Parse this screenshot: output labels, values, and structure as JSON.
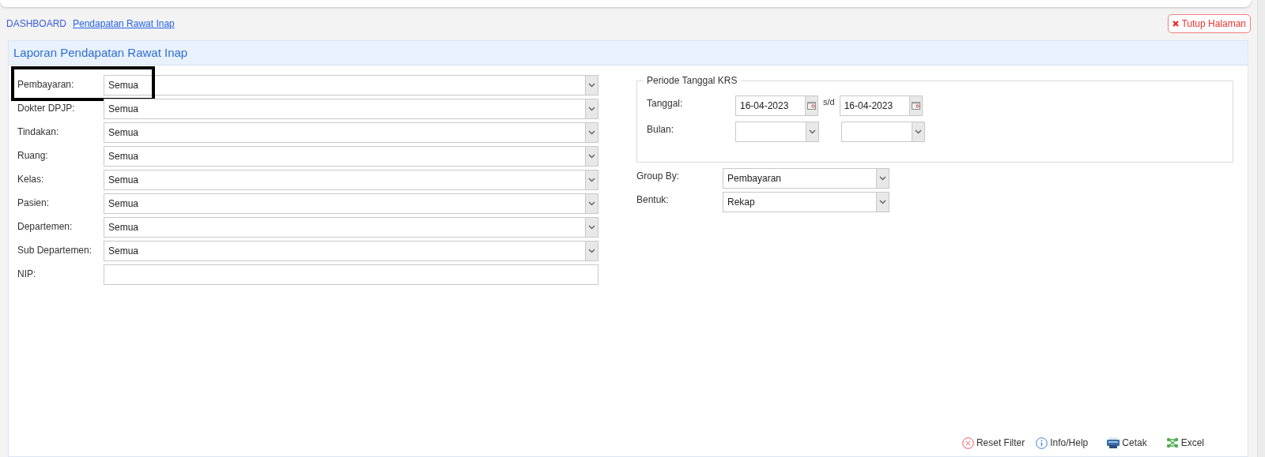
{
  "breadcrumb": [
    {
      "label": "DASHBOARD",
      "kind": "plain"
    },
    {
      "label": "Pendapatan Rawat Inap",
      "kind": "link"
    }
  ],
  "close_button": {
    "label": "Tutup Halaman"
  },
  "panel": {
    "title": "Laporan Pendapatan Rawat Inap"
  },
  "filters": [
    {
      "label": "Pembayaran:",
      "kind": "select",
      "value": "Semua",
      "highlighted": true
    },
    {
      "label": "Dokter DPJP:",
      "kind": "select",
      "value": "Semua",
      "highlighted": false
    },
    {
      "label": "Tindakan:",
      "kind": "select",
      "value": "Semua",
      "highlighted": false
    },
    {
      "label": "Ruang:",
      "kind": "select",
      "value": "Semua",
      "highlighted": false
    },
    {
      "label": "Kelas:",
      "kind": "select",
      "value": "Semua",
      "highlighted": false
    },
    {
      "label": "Pasien:",
      "kind": "select",
      "value": "Semua",
      "highlighted": false
    },
    {
      "label": "Departemen:",
      "kind": "select",
      "value": "Semua",
      "highlighted": false
    },
    {
      "label": "Sub Departemen:",
      "kind": "select",
      "value": "Semua",
      "highlighted": false
    },
    {
      "label": "NIP:",
      "kind": "text",
      "highlighted": false
    }
  ],
  "period": {
    "legend": "Periode Tanggal KRS",
    "date_label": "Tanggal:",
    "date_from": "16-04-2023",
    "separator": "s/d",
    "date_to": "16-04-2023",
    "month_label": "Bulan:"
  },
  "options": [
    {
      "label": "Group By:",
      "value": "Pembayaran"
    },
    {
      "label": "Bentuk:",
      "value": "Rekap"
    }
  ],
  "actions": [
    {
      "label": "Reset Filter",
      "kind": "reset"
    },
    {
      "label": "Info/Help",
      "kind": "info"
    },
    {
      "label": "Cetak",
      "kind": "print"
    },
    {
      "label": "Excel",
      "kind": "excel"
    }
  ]
}
